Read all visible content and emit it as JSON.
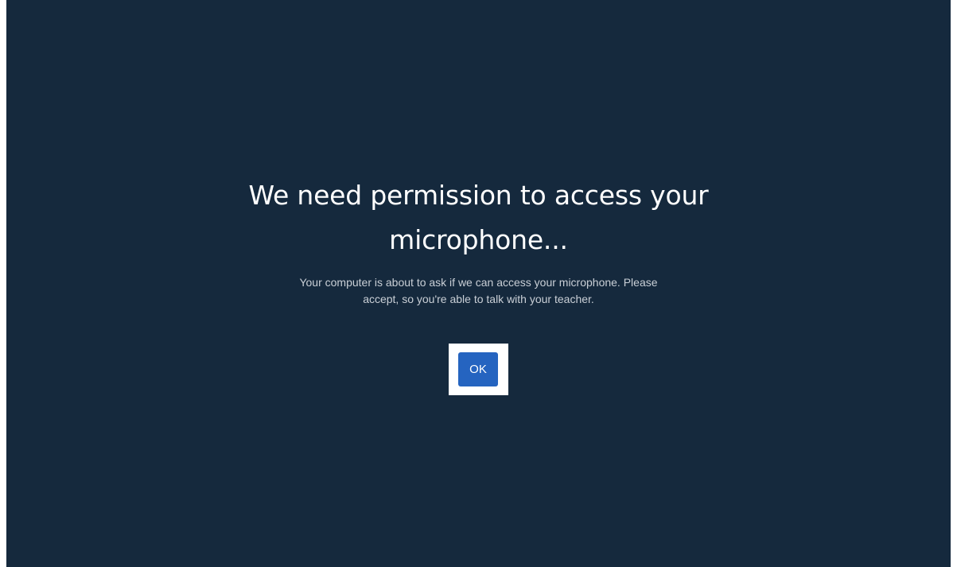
{
  "dialog": {
    "title_line1": "We need permission to access your",
    "title_line2": "microphone...",
    "description_line1": "Your computer is about to ask if we can access your microphone. Please",
    "description_line2": "accept, so you're able to talk with your teacher.",
    "ok_label": "OK"
  },
  "colors": {
    "background": "#15293d",
    "button": "#2564c0",
    "focus_outline": "#ffffff",
    "title_text": "#ffffff",
    "description_text": "#c9cfd6"
  }
}
